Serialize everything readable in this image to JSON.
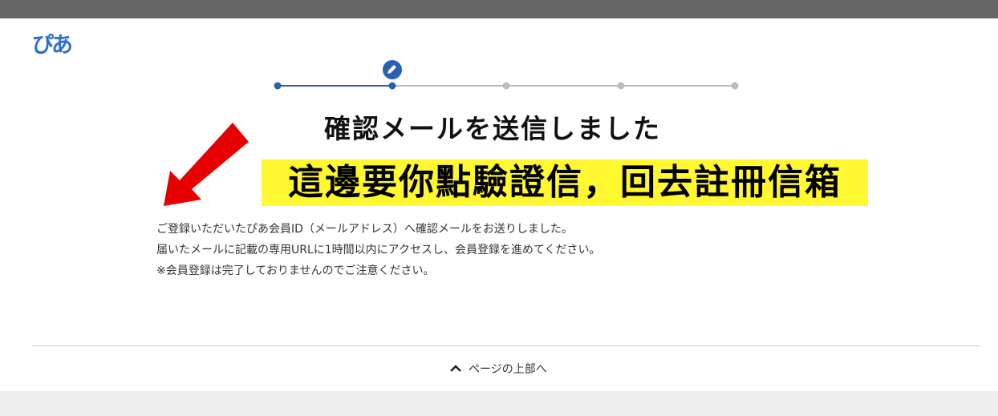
{
  "header": {
    "logo_text": "ぴあ"
  },
  "stepper": {
    "steps": 5,
    "current_step": 2,
    "current_icon": "pencil-icon"
  },
  "main": {
    "title": "確認メールを送信しました",
    "annotation_overlay": "這邊要你點驗證信，回去註冊信箱",
    "messages": [
      "ご登録いただいたぴあ会員ID（メールアドレス）へ確認メールをお送りしました。",
      "届いたメールに記載の専用URLに1時間以内にアクセスし、会員登録を進めてください。",
      "※会員登録は完了しておりませんのでご注意ください。"
    ]
  },
  "footer": {
    "page_top_label": "ページの上部へ",
    "page_top_icon": "chevron-up-icon"
  },
  "colors": {
    "topbar": "#666666",
    "brand": "#2a6fd1",
    "progress_active": "#2a5fb4",
    "progress_inactive": "#bbbbbb",
    "highlight": "#fff730",
    "arrow": "#e60000"
  }
}
